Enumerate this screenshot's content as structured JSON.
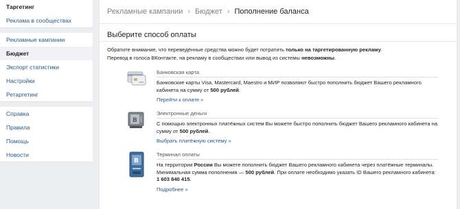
{
  "sidebar": {
    "group1": [
      {
        "label": "Таргетинг"
      },
      {
        "label": "Реклама в сообществах"
      }
    ],
    "group2": [
      {
        "label": "Рекламные кампании"
      },
      {
        "label": "Бюджет"
      },
      {
        "label": "Экспорт статистики"
      },
      {
        "label": "Настройки"
      },
      {
        "label": "Ретаргетинг"
      }
    ],
    "group3": [
      {
        "label": "Справка"
      },
      {
        "label": "Правила"
      },
      {
        "label": "Помощь"
      },
      {
        "label": "Новости"
      }
    ]
  },
  "breadcrumb": {
    "item1": "Рекламные кампании",
    "item2": "Бюджет",
    "current": "Пополнение баланса",
    "sep": "›"
  },
  "main": {
    "title": "Выберите способ оплаты",
    "notice_1": "Обратите внимание, что переведённые средства можно будет потратить ",
    "notice_1_bold": "только на таргетированную рекламу",
    "notice_1_end": ".",
    "notice_2": "Перевод в голоса ВКонтакте, на рекламу в сообществах или вывод из системы ",
    "notice_2_bold": "невозможны",
    "notice_2_end": "."
  },
  "methods": [
    {
      "icon": "bank-card-icon",
      "name": "Банковская карта",
      "text": "Банковские карты Visa, Mastercard, Maestro и МИР позволяют быстро пополнить бюджет Вашего рекламного кабинета на сумму от ",
      "amount": "500 рублей",
      "end": ".",
      "link": "Перейти к оплате »"
    },
    {
      "icon": "e-wallet-icon",
      "name": "Электронные деньги",
      "text": "С помощью электронных платёжных систем Вы можете быстро пополнить бюджет Вашего рекламного кабинета на сумму от ",
      "amount": "500 рублей",
      "end": ".",
      "link": "Выбрать платёжную систему »"
    },
    {
      "icon": "payment-terminal-icon",
      "name": "Терминал оплаты",
      "text_a": "На территории ",
      "country": "России",
      "text_b": " Вы можете пополнить бюджет Вашего рекламного кабинета через платёжные терминалы. Минимальная сумма пополнения — ",
      "amount": "500 рублей",
      "text_c": ". При оплате необходимо указать ID Вашего рекламного кабинета: ",
      "cabinet_id": "1 603 840 415",
      "end": ".",
      "link": "Подробнее »"
    }
  ],
  "colors": {
    "accent": "#2a5885",
    "bg": "#edeef0"
  }
}
